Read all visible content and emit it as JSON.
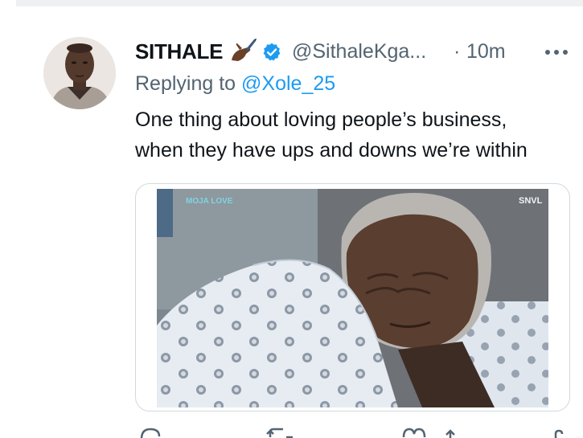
{
  "tweet": {
    "author_name": "SITHALE",
    "handle": "@SithaleKga...",
    "separator": "·",
    "time": "10m",
    "reply_prefix": "Replying to ",
    "reply_to": "@Xole_25",
    "text_line1": "One thing about loving people’s business,",
    "text_line2": "when they have ups and downs we’re within",
    "verified": true
  },
  "media": {
    "watermark_left": "MOJA LOVE",
    "watermark_right": "SNVL"
  },
  "icons": {
    "pen": "writing-hand-emoji",
    "verified": "verified-badge-icon",
    "more": "more-dots-icon",
    "actions": [
      "reply-icon",
      "retweet-icon",
      "like-icon",
      "share-icon"
    ]
  },
  "colors": {
    "text": "#0f1419",
    "secondary": "#536471",
    "accent": "#1d9bf0",
    "border": "#cfd9de"
  }
}
